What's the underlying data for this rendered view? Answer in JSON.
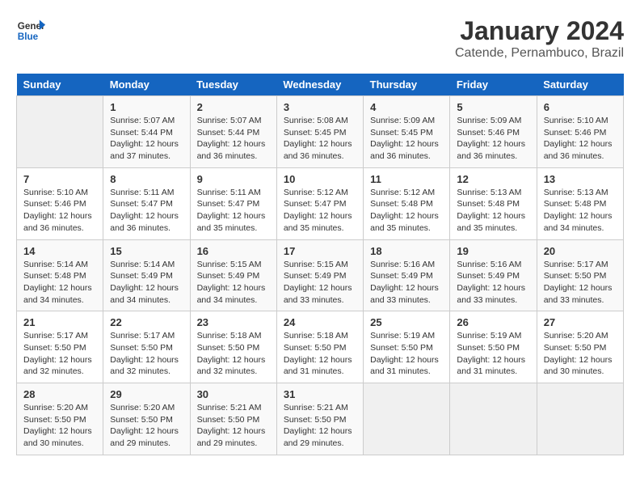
{
  "header": {
    "logo_line1": "General",
    "logo_line2": "Blue",
    "title": "January 2024",
    "subtitle": "Catende, Pernambuco, Brazil"
  },
  "calendar": {
    "days_of_week": [
      "Sunday",
      "Monday",
      "Tuesday",
      "Wednesday",
      "Thursday",
      "Friday",
      "Saturday"
    ],
    "weeks": [
      [
        {
          "day": "",
          "info": ""
        },
        {
          "day": "1",
          "info": "Sunrise: 5:07 AM\nSunset: 5:44 PM\nDaylight: 12 hours\nand 37 minutes."
        },
        {
          "day": "2",
          "info": "Sunrise: 5:07 AM\nSunset: 5:44 PM\nDaylight: 12 hours\nand 36 minutes."
        },
        {
          "day": "3",
          "info": "Sunrise: 5:08 AM\nSunset: 5:45 PM\nDaylight: 12 hours\nand 36 minutes."
        },
        {
          "day": "4",
          "info": "Sunrise: 5:09 AM\nSunset: 5:45 PM\nDaylight: 12 hours\nand 36 minutes."
        },
        {
          "day": "5",
          "info": "Sunrise: 5:09 AM\nSunset: 5:46 PM\nDaylight: 12 hours\nand 36 minutes."
        },
        {
          "day": "6",
          "info": "Sunrise: 5:10 AM\nSunset: 5:46 PM\nDaylight: 12 hours\nand 36 minutes."
        }
      ],
      [
        {
          "day": "7",
          "info": "Sunrise: 5:10 AM\nSunset: 5:46 PM\nDaylight: 12 hours\nand 36 minutes."
        },
        {
          "day": "8",
          "info": "Sunrise: 5:11 AM\nSunset: 5:47 PM\nDaylight: 12 hours\nand 36 minutes."
        },
        {
          "day": "9",
          "info": "Sunrise: 5:11 AM\nSunset: 5:47 PM\nDaylight: 12 hours\nand 35 minutes."
        },
        {
          "day": "10",
          "info": "Sunrise: 5:12 AM\nSunset: 5:47 PM\nDaylight: 12 hours\nand 35 minutes."
        },
        {
          "day": "11",
          "info": "Sunrise: 5:12 AM\nSunset: 5:48 PM\nDaylight: 12 hours\nand 35 minutes."
        },
        {
          "day": "12",
          "info": "Sunrise: 5:13 AM\nSunset: 5:48 PM\nDaylight: 12 hours\nand 35 minutes."
        },
        {
          "day": "13",
          "info": "Sunrise: 5:13 AM\nSunset: 5:48 PM\nDaylight: 12 hours\nand 34 minutes."
        }
      ],
      [
        {
          "day": "14",
          "info": "Sunrise: 5:14 AM\nSunset: 5:48 PM\nDaylight: 12 hours\nand 34 minutes."
        },
        {
          "day": "15",
          "info": "Sunrise: 5:14 AM\nSunset: 5:49 PM\nDaylight: 12 hours\nand 34 minutes."
        },
        {
          "day": "16",
          "info": "Sunrise: 5:15 AM\nSunset: 5:49 PM\nDaylight: 12 hours\nand 34 minutes."
        },
        {
          "day": "17",
          "info": "Sunrise: 5:15 AM\nSunset: 5:49 PM\nDaylight: 12 hours\nand 33 minutes."
        },
        {
          "day": "18",
          "info": "Sunrise: 5:16 AM\nSunset: 5:49 PM\nDaylight: 12 hours\nand 33 minutes."
        },
        {
          "day": "19",
          "info": "Sunrise: 5:16 AM\nSunset: 5:49 PM\nDaylight: 12 hours\nand 33 minutes."
        },
        {
          "day": "20",
          "info": "Sunrise: 5:17 AM\nSunset: 5:50 PM\nDaylight: 12 hours\nand 33 minutes."
        }
      ],
      [
        {
          "day": "21",
          "info": "Sunrise: 5:17 AM\nSunset: 5:50 PM\nDaylight: 12 hours\nand 32 minutes."
        },
        {
          "day": "22",
          "info": "Sunrise: 5:17 AM\nSunset: 5:50 PM\nDaylight: 12 hours\nand 32 minutes."
        },
        {
          "day": "23",
          "info": "Sunrise: 5:18 AM\nSunset: 5:50 PM\nDaylight: 12 hours\nand 32 minutes."
        },
        {
          "day": "24",
          "info": "Sunrise: 5:18 AM\nSunset: 5:50 PM\nDaylight: 12 hours\nand 31 minutes."
        },
        {
          "day": "25",
          "info": "Sunrise: 5:19 AM\nSunset: 5:50 PM\nDaylight: 12 hours\nand 31 minutes."
        },
        {
          "day": "26",
          "info": "Sunrise: 5:19 AM\nSunset: 5:50 PM\nDaylight: 12 hours\nand 31 minutes."
        },
        {
          "day": "27",
          "info": "Sunrise: 5:20 AM\nSunset: 5:50 PM\nDaylight: 12 hours\nand 30 minutes."
        }
      ],
      [
        {
          "day": "28",
          "info": "Sunrise: 5:20 AM\nSunset: 5:50 PM\nDaylight: 12 hours\nand 30 minutes."
        },
        {
          "day": "29",
          "info": "Sunrise: 5:20 AM\nSunset: 5:50 PM\nDaylight: 12 hours\nand 29 minutes."
        },
        {
          "day": "30",
          "info": "Sunrise: 5:21 AM\nSunset: 5:50 PM\nDaylight: 12 hours\nand 29 minutes."
        },
        {
          "day": "31",
          "info": "Sunrise: 5:21 AM\nSunset: 5:50 PM\nDaylight: 12 hours\nand 29 minutes."
        },
        {
          "day": "",
          "info": ""
        },
        {
          "day": "",
          "info": ""
        },
        {
          "day": "",
          "info": ""
        }
      ]
    ]
  }
}
